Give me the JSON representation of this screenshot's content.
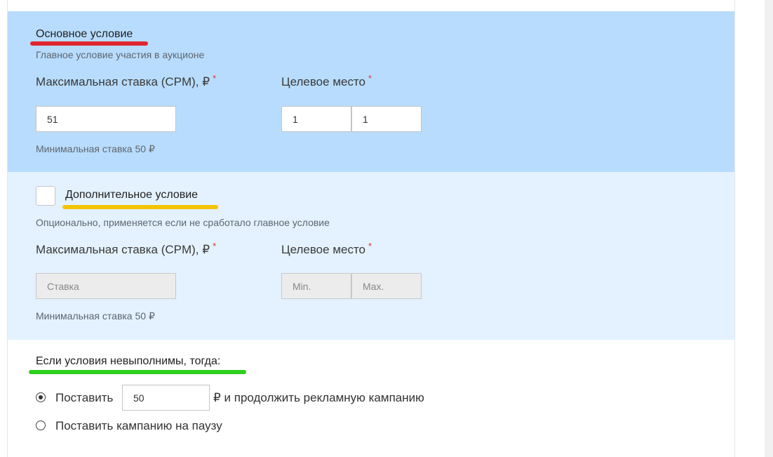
{
  "main_condition": {
    "title": "Основное условие",
    "subtitle": "Главное условие участия в аукционе",
    "bid_label": "Максимальная ставка (CPM), ₽",
    "bid_value": "51",
    "place_label": "Целевое место",
    "place_min_value": "1",
    "place_max_value": "1",
    "min_bid_hint": "Минимальная ставка 50 ₽",
    "required_mark": "*",
    "underline_color": "#e0272f"
  },
  "extra_condition": {
    "title": "Дополнительное условие",
    "subtitle": "Опционально, применяется если не сработало главное условие",
    "bid_label": "Максимальная ставка (CPM), ₽",
    "bid_placeholder": "Ставка",
    "place_label": "Целевое место",
    "place_min_placeholder": "Min.",
    "place_max_placeholder": "Max.",
    "min_bid_hint": "Минимальная ставка 50 ₽",
    "required_mark": "*",
    "enabled": false,
    "underline_color": "#f5c400"
  },
  "fallback": {
    "title": "Если условия невыполнимы, тогда:",
    "option_set_label": "Поставить",
    "option_set_value": "50",
    "option_set_suffix": "₽ и продолжить рекламную кампанию",
    "option_pause_label": "Поставить кампанию на паузу",
    "selected": "set",
    "underline_color": "#2fcf1f"
  },
  "colors": {
    "main_section_bg": "#b8dcfd",
    "extra_section_bg": "#e3f2fe",
    "required": "#e0353b"
  }
}
